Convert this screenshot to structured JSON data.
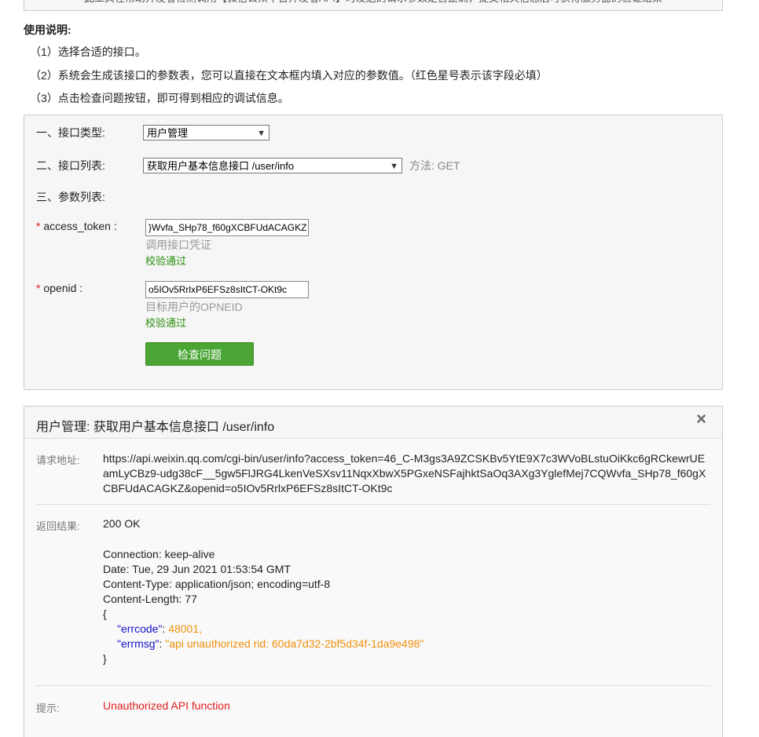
{
  "top_notice": "此工具在帮助开发者检测调用【微信公众平台开发者API】时发送的请求参数是否正确，提交相关信息后可获得服务器的验证结果",
  "usage": {
    "title": "使用说明:",
    "steps": [
      "（1）选择合适的接口。",
      "（2）系统会生成该接口的参数表，您可以直接在文本框内填入对应的参数值。（红色星号表示该字段必填）",
      "（3）点击检查问题按钮，即可得到相应的调试信息。"
    ]
  },
  "form": {
    "api_type_label": "一、接口类型:",
    "api_type_value": "用户管理",
    "api_list_label": "二、接口列表:",
    "api_list_value": "获取用户基本信息接口 /user/info",
    "method_text": "方法: GET",
    "params_label": "三、参数列表:",
    "params": [
      {
        "required_mark": "*",
        "name": "access_token :",
        "value": "}Wvfa_SHp78_f60gXCBFUdACAGKZ",
        "hint": "调用接口凭证",
        "status": "校验通过"
      },
      {
        "required_mark": "*",
        "name": "openid :",
        "value": "o5IOv5RrlxP6EFSz8sItCT-OKt9c",
        "hint": "目标用户的OPNEID",
        "status": "校验通过"
      }
    ],
    "check_button": "检查问题"
  },
  "result": {
    "title": "用户管理: 获取用户基本信息接口 /user/info",
    "close_icon": "×",
    "request_label": "请求地址:",
    "request_url": "https://api.weixin.qq.com/cgi-bin/user/info?access_token=46_C-M3gs3A9ZCSKBv5YtE9X7c3WVoBLstuOiKkc6gRCkewrUEamLyCBz9-udg38cF__5gw5FlJRG4LkenVeSXsv11NqxXbwX5PGxeNSFajhktSaOq3AXg3YglefMej7CQWvfa_SHp78_f60gXCBFUdACAGKZ&openid=o5IOv5RrlxP6EFSz8sItCT-OKt9c",
    "response_label": "返回结果:",
    "status_line": "200 OK",
    "headers": [
      "Connection: keep-alive",
      "Date: Tue, 29 Jun 2021 01:53:54 GMT",
      "Content-Type: application/json; encoding=utf-8",
      "Content-Length: 77"
    ],
    "json_open": "{",
    "json_close": "}",
    "json_errcode_key": "\"errcode\"",
    "json_errcode_value": "48001,",
    "json_errmsg_key": "\"errmsg\"",
    "json_errmsg_value": "\"api unauthorized rid: 60da7d32-2bf5d34f-1da9e498\"",
    "colon": ": ",
    "tip_label": "提示:",
    "tip_text": "Unauthorized API function"
  },
  "colors": {
    "button_green": "#4aa534",
    "ok_green": "#2a8f0c",
    "error_red": "#e02020",
    "json_key_blue": "#1212c8",
    "json_value_orange": "#f0900a"
  }
}
